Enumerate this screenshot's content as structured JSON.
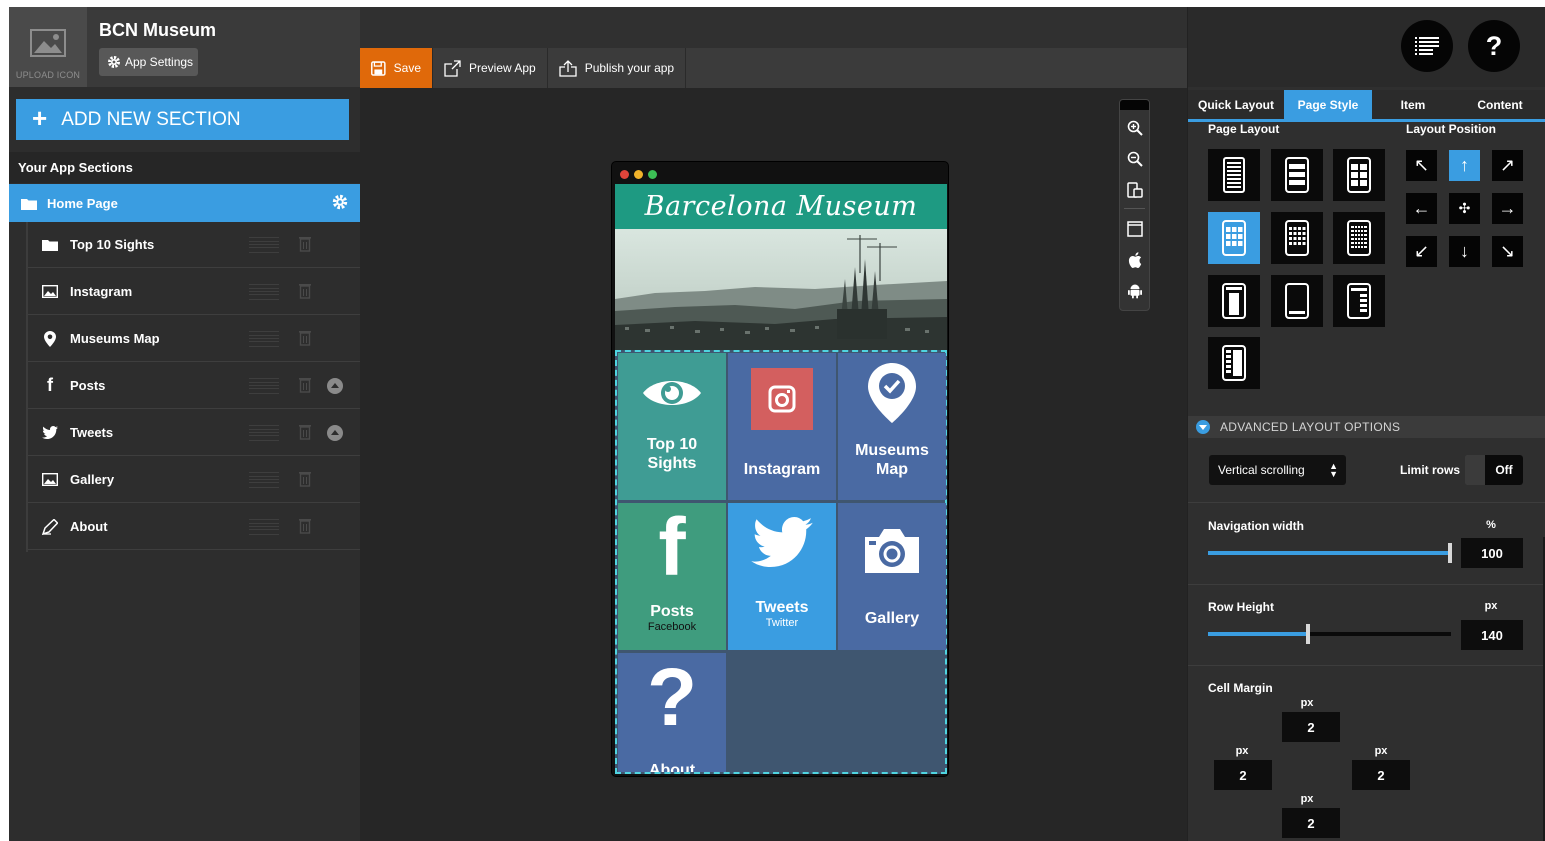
{
  "app": {
    "title": "BCN Museum",
    "upload_icon_label": "UPLOAD ICON",
    "settings_label": "App Settings"
  },
  "sidebar": {
    "add_section_label": "ADD NEW SECTION",
    "sections_label": "Your App Sections",
    "home_label": "Home Page",
    "items": [
      {
        "label": "Top 10 Sights",
        "icon": "folder-icon"
      },
      {
        "label": "Instagram",
        "icon": "image-icon"
      },
      {
        "label": "Museums Map",
        "icon": "map-pin-icon"
      },
      {
        "label": "Posts",
        "icon": "facebook-icon"
      },
      {
        "label": "Tweets",
        "icon": "twitter-icon"
      },
      {
        "label": "Gallery",
        "icon": "image-icon"
      },
      {
        "label": "About",
        "icon": "pen-icon"
      }
    ]
  },
  "toolbar": {
    "save_label": "Save",
    "preview_label": "Preview App",
    "publish_label": "Publish your app"
  },
  "preview": {
    "header_title": "Barcelona Museum",
    "tiles": [
      {
        "title": "Top 10\nSights",
        "subtitle": "",
        "color": "#3f9c94",
        "icon": "eye-icon"
      },
      {
        "title": "Instagram",
        "subtitle": "",
        "color": "#4a6aa3",
        "icon": "instagram-icon"
      },
      {
        "title": "Museums\nMap",
        "subtitle": "",
        "color": "#4a6aa3",
        "icon": "map-pin-icon"
      },
      {
        "title": "Posts",
        "subtitle": "Facebook",
        "color": "#3f9c7e",
        "icon": "facebook-icon"
      },
      {
        "title": "Tweets",
        "subtitle": "Twitter",
        "color": "#3a9de1",
        "icon": "twitter-icon"
      },
      {
        "title": "Gallery",
        "subtitle": "",
        "color": "#4a6aa3",
        "icon": "camera-icon"
      },
      {
        "title": "About",
        "subtitle": "",
        "color": "#4a6aa3",
        "icon": "question-icon"
      }
    ]
  },
  "panel": {
    "tabs": [
      "Quick Layout",
      "Page Style",
      "Item",
      "Content"
    ],
    "active_tab": "Page Style",
    "page_layout_label": "Page Layout",
    "layout_position_label": "Layout Position",
    "advanced_label": "ADVANCED LAYOUT OPTIONS",
    "scroll_mode": "Vertical scrolling",
    "limit_rows_label": "Limit rows",
    "limit_rows_value": "Off",
    "nav_width_label": "Navigation width",
    "nav_width_unit": "%",
    "nav_width_value": "100",
    "row_height_label": "Row Height",
    "row_height_unit": "px",
    "row_height_value": "140",
    "row_height_fraction": 0.41,
    "cell_margin_label": "Cell Margin",
    "margin_unit": "px",
    "margin_top": "2",
    "margin_left": "2",
    "margin_right": "2",
    "margin_bottom": "2"
  },
  "colors": {
    "accent": "#3a9de1",
    "save": "#e0690a",
    "header_green": "#1e9a82"
  }
}
